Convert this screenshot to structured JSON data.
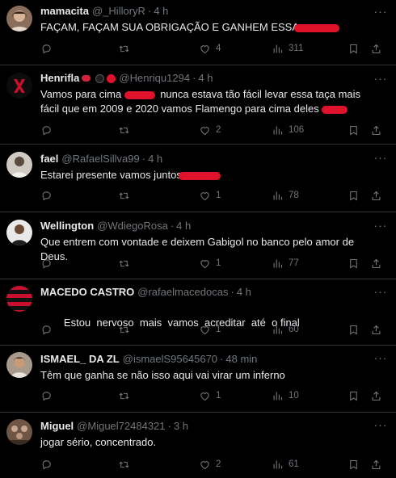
{
  "tweets": [
    {
      "name": "mamacita",
      "handle": "@_HilloryR",
      "time": "4 h",
      "text": "FAÇAM, FAÇAM SUA OBRIGAÇÃO E GANHEM ESSA",
      "redacted": true,
      "replies": "",
      "retweets": "",
      "likes": "4",
      "views": "311"
    },
    {
      "name": "Henrifla",
      "handle": "@Henriqu1294",
      "time": "4 h",
      "text": "Vamos para cima",
      "text_b": "nunca estava tão fácil levar essa taça mais fácil que em 2009 e 2020 vamos Flamengo para cima deles",
      "redacted": true,
      "replies": "",
      "retweets": "",
      "likes": "2",
      "views": "106"
    },
    {
      "name": "fael",
      "handle": "@RafaelSillva99",
      "time": "4 h",
      "text": "Estarei presente vamos juntos",
      "redacted": true,
      "replies": "",
      "retweets": "",
      "likes": "1",
      "views": "78"
    },
    {
      "name": "Wellington",
      "handle": "@WdiegoRosa",
      "time": "4 h",
      "text": "Que entrem com vontade e deixem Gabigol no banco pelo amor de Deus.",
      "replies": "",
      "retweets": "",
      "likes": "1",
      "views": "77"
    },
    {
      "name": "MACEDO CASTRO",
      "handle": "@rafaelmacedocas",
      "time": "4 h",
      "text": "Estou  nervoso  mais  vamos  acreditar  até  o final",
      "replies": "",
      "retweets": "",
      "likes": "1",
      "views": "60"
    },
    {
      "name": "ISMAEL_ DA ZL",
      "handle": "@ismaelS95645670",
      "time": "48 min",
      "text": "Têm que ganha se não isso aqui vai virar um inferno",
      "replies": "",
      "retweets": "",
      "likes": "1",
      "views": "10"
    },
    {
      "name": "Miguel",
      "handle": "@Miguel72484321",
      "time": "3 h",
      "text": "jogar sério, concentrado.",
      "replies": "",
      "retweets": "",
      "likes": "2",
      "views": "61"
    }
  ],
  "separator": "·",
  "colors": {
    "background": "#000000",
    "text": "#e7e9ea",
    "muted": "#71767b",
    "border": "#2f3336",
    "redaction": "#e0122b"
  },
  "icons": {
    "reply": "reply-icon",
    "retweet": "retweet-icon",
    "like": "heart-icon",
    "views": "views-chart-icon",
    "bookmark": "bookmark-icon",
    "share": "share-icon",
    "more": "more-dots-icon"
  }
}
